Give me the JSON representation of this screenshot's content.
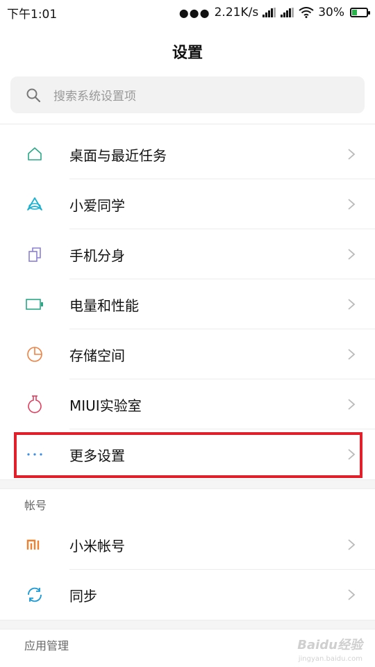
{
  "status_bar": {
    "time": "下午1:01",
    "network_speed": "2.21K/s",
    "battery_percent": "30%",
    "battery_level": 0.3
  },
  "page_title": "设置",
  "search": {
    "placeholder": "搜索系统设置项"
  },
  "items": [
    {
      "label": "桌面与最近任务",
      "icon": "home-icon",
      "color": "#2aa886"
    },
    {
      "label": "小爱同学",
      "icon": "xiaoai-icon",
      "color": "#1ab0d0"
    },
    {
      "label": "手机分身",
      "icon": "dual-device-icon",
      "color": "#8a7fd4"
    },
    {
      "label": "电量和性能",
      "icon": "battery-icon",
      "color": "#2aa886"
    },
    {
      "label": "存储空间",
      "icon": "storage-pie-icon",
      "color": "#f08040"
    },
    {
      "label": "MIUI实验室",
      "icon": "flask-icon",
      "color": "#e04060"
    },
    {
      "label": "更多设置",
      "icon": "more-dots-icon",
      "color": "#3a8ee6"
    }
  ],
  "section_account": {
    "header": "帐号",
    "items": [
      {
        "label": "小米帐号",
        "icon": "mi-logo-icon",
        "color": "#f08030"
      },
      {
        "label": "同步",
        "icon": "sync-icon",
        "color": "#1a9ad6"
      }
    ]
  },
  "section_apps": {
    "header": "应用管理"
  },
  "watermark": {
    "text": "Baidu经验",
    "sub": "jingyan.baidu.com"
  }
}
